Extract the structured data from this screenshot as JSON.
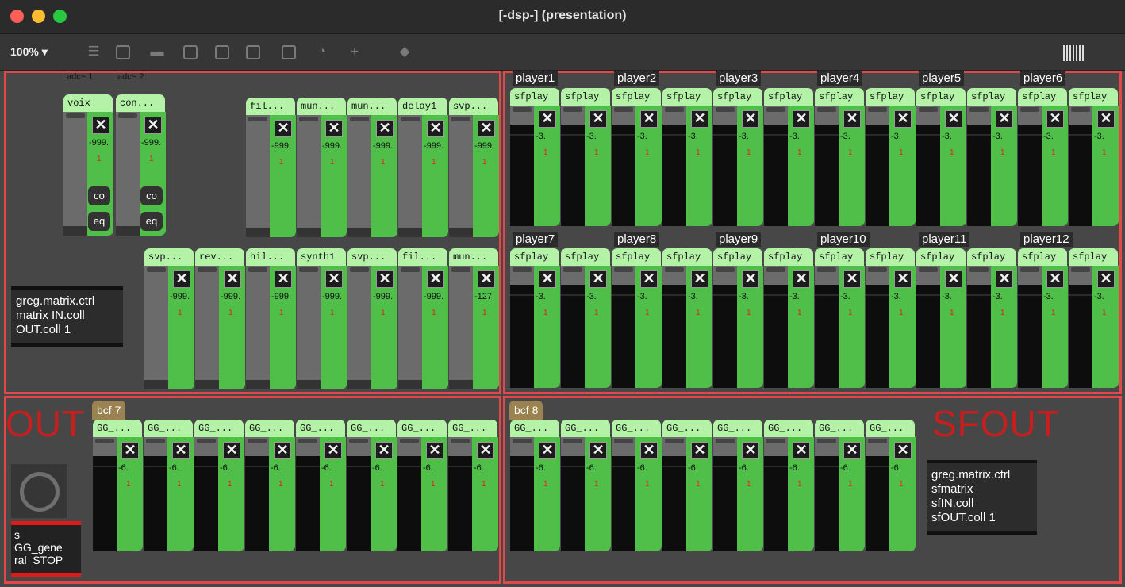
{
  "window": {
    "title": "[-dsp-] (presentation)"
  },
  "toolbar": {
    "zoom": "100%"
  },
  "adc": [
    "adc~ 1",
    "adc~ 2"
  ],
  "input_strips": [
    {
      "name": "voix",
      "value": "-999.",
      "count": "1"
    },
    {
      "name": "con...",
      "value": "-999.",
      "count": "1"
    }
  ],
  "small_buttons": [
    "co",
    "eq"
  ],
  "fx_row1": [
    {
      "name": "fil...",
      "value": "-999.",
      "count": "1"
    },
    {
      "name": "mun...",
      "value": "-999.",
      "count": "1"
    },
    {
      "name": "mun...",
      "value": "-999.",
      "count": "1"
    },
    {
      "name": "delay1",
      "value": "-999.",
      "count": "1"
    },
    {
      "name": "svp...",
      "value": "-999.",
      "count": "1"
    }
  ],
  "fx_row2": [
    {
      "name": "svp...",
      "value": "-999.",
      "count": "1"
    },
    {
      "name": "rev...",
      "value": "-999.",
      "count": "1"
    },
    {
      "name": "hil...",
      "value": "-999.",
      "count": "1"
    },
    {
      "name": "synth1",
      "value": "-999.",
      "count": "1"
    },
    {
      "name": "svp...",
      "value": "-999.",
      "count": "1"
    },
    {
      "name": "fil...",
      "value": "-999.",
      "count": "1"
    },
    {
      "name": "mun...",
      "value": "-127.",
      "count": "1"
    }
  ],
  "matrix_label": [
    "greg.matrix.ctrl",
    "matrix IN.coll",
    "OUT.coll 1"
  ],
  "players_row1": [
    "player1",
    "player2",
    "player3",
    "player4",
    "player5",
    "player6"
  ],
  "players_row2": [
    "player7",
    "player8",
    "player9",
    "player10",
    "player11",
    "player12"
  ],
  "sf_strip": {
    "name": "sfplay",
    "value": "-3.",
    "count": "1"
  },
  "out": {
    "title": "OUT",
    "bcf": "bcf 7",
    "strip_name": "GG_...",
    "value": "-6.",
    "count": "1"
  },
  "sfout": {
    "title": "SFOUT",
    "bcf": "bcf 8",
    "strip_name": "GG_...",
    "value": "-6.",
    "count": "1"
  },
  "sf_matrix_label": [
    "greg.matrix.ctrl",
    "sfmatrix",
    "sfIN.coll",
    "sfOUT.coll 1"
  ],
  "stop_label": [
    "s",
    "GG_gene",
    "ral_STOP"
  ],
  "icons": [
    "grid-icon",
    "close-icon",
    "knob-icon"
  ]
}
